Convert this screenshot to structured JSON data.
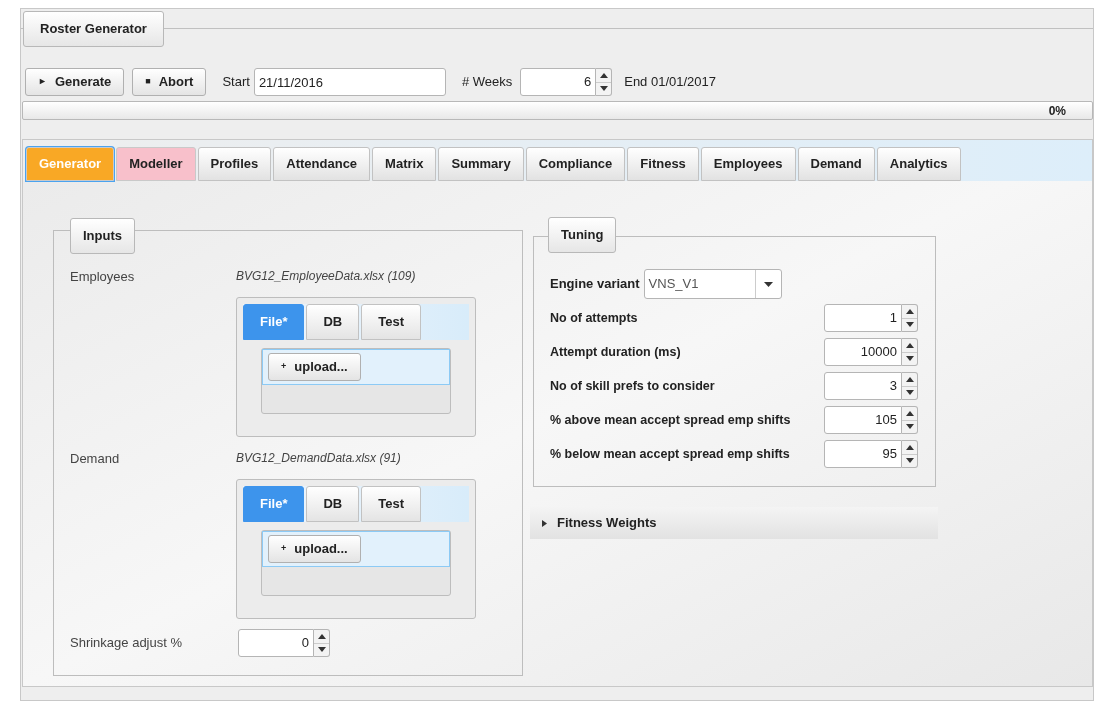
{
  "window": {
    "title": "Roster Generator"
  },
  "toolbar": {
    "generate_button": {
      "icon": "►",
      "label": "Generate"
    },
    "abort_button": {
      "icon": "■",
      "label": "Abort"
    },
    "start_label": "Start",
    "start_value": "21/11/2016",
    "weeks_label": "# Weeks",
    "weeks_value": "6",
    "end_label": "End 01/01/2017"
  },
  "progress": {
    "level": 0,
    "reading": "0%"
  },
  "tabs": [
    {
      "label": "Generator",
      "selected": true,
      "color": "#f9a825"
    },
    {
      "label": "Modeller",
      "selected": false,
      "color": "#f8c0cb"
    },
    {
      "label": "Profiles",
      "selected": false
    },
    {
      "label": "Attendance",
      "selected": false
    },
    {
      "label": "Matrix",
      "selected": false
    },
    {
      "label": "Summary",
      "selected": false
    },
    {
      "label": "Compliance",
      "selected": false
    },
    {
      "label": "Fitness",
      "selected": false
    },
    {
      "label": "Employees",
      "selected": false
    },
    {
      "label": "Demand",
      "selected": false
    },
    {
      "label": "Analytics",
      "selected": false
    }
  ],
  "inputs": {
    "title": "Inputs",
    "sources": [
      {
        "label": "Employees",
        "file": "BVG12_EmployeeData.xlsx (109)",
        "tabs": [
          {
            "label": "File*",
            "selected": true
          },
          {
            "label": "DB",
            "selected": false
          },
          {
            "label": "Test",
            "selected": false
          }
        ],
        "upload_button": {
          "icon": "+",
          "label": "upload..."
        }
      },
      {
        "label": "Demand",
        "file": "BVG12_DemandData.xlsx (91)",
        "tabs": [
          {
            "label": "File*",
            "selected": true
          },
          {
            "label": "DB",
            "selected": false
          },
          {
            "label": "Test",
            "selected": false
          }
        ],
        "upload_button": {
          "icon": "+",
          "label": "upload..."
        }
      }
    ],
    "shrinkage": {
      "label": "Shrinkage adjust %",
      "value": "0"
    }
  },
  "tuning": {
    "title": "Tuning",
    "engine_variant": {
      "label": "Engine variant",
      "value": "VNS_V1"
    },
    "parameters": [
      {
        "label": "No of attempts",
        "value": "1"
      },
      {
        "label": "Attempt duration (ms)",
        "value": "10000"
      },
      {
        "label": "No of skill prefs to consider",
        "value": "3"
      },
      {
        "label": "% above mean accept spread emp shifts",
        "value": "105"
      },
      {
        "label": "% below mean accept spread emp shifts",
        "value": "95"
      }
    ]
  },
  "fitness_weights": {
    "label": "Fitness Weights",
    "expanded": false
  }
}
